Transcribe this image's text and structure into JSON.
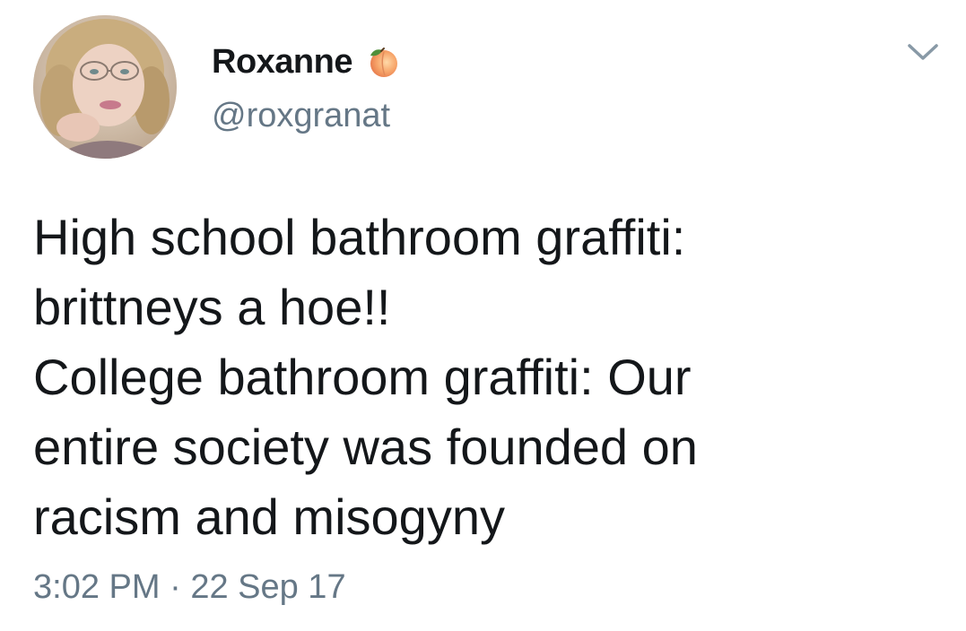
{
  "author": {
    "display_name": "Roxanne",
    "name_emoji": "peach-icon",
    "handle": "@roxgranat",
    "avatar": "avatar-photo"
  },
  "menu": {
    "icon": "chevron-down-icon"
  },
  "tweet": {
    "lines": [
      "High school bathroom graffiti:",
      "brittneys a hoe!!",
      "College bathroom graffiti: Our",
      "entire society was founded on",
      "racism and misogyny"
    ]
  },
  "meta": {
    "time": "3:02 PM",
    "separator": " · ",
    "date": "22 Sep 17"
  },
  "colors": {
    "text_primary": "#14171a",
    "text_secondary": "#657786",
    "caret": "#8899a6",
    "background": "#ffffff"
  }
}
